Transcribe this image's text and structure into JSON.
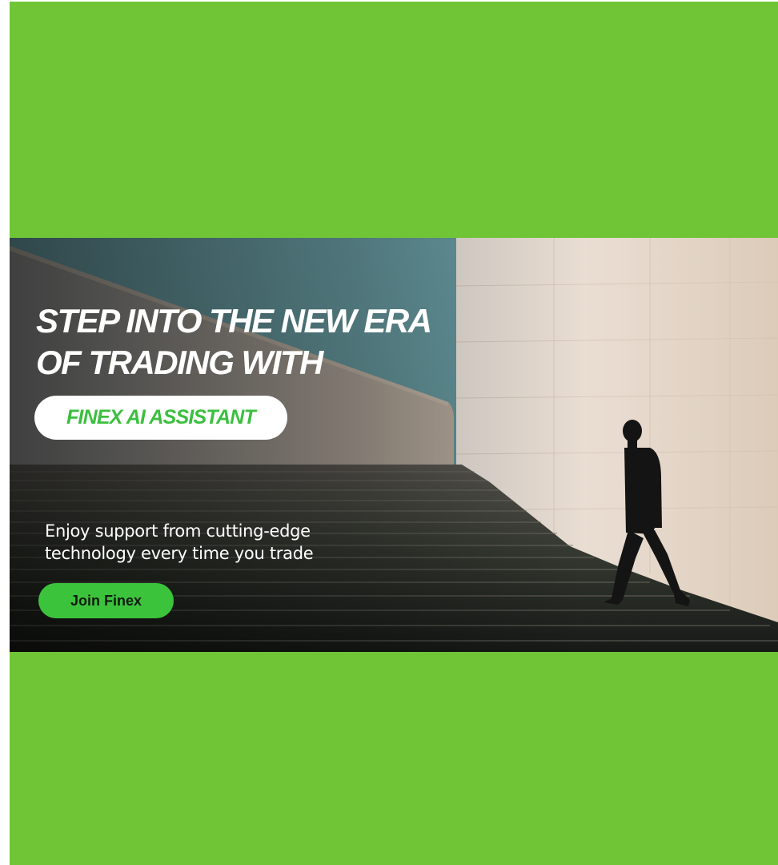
{
  "banner": {
    "headline_line1": "STEP INTO THE NEW ERA",
    "headline_line2": "OF TRADING WITH",
    "product_name": "FINEX AI ASSISTANT",
    "subtext_line1": "Enjoy support from cutting-edge",
    "subtext_line2": "technology every time you trade",
    "cta_label": "Join Finex"
  },
  "colors": {
    "page_background": "#70c536",
    "accent_green": "#3cc33c",
    "headline_text": "#ffffff",
    "pill_background": "#ffffff"
  }
}
